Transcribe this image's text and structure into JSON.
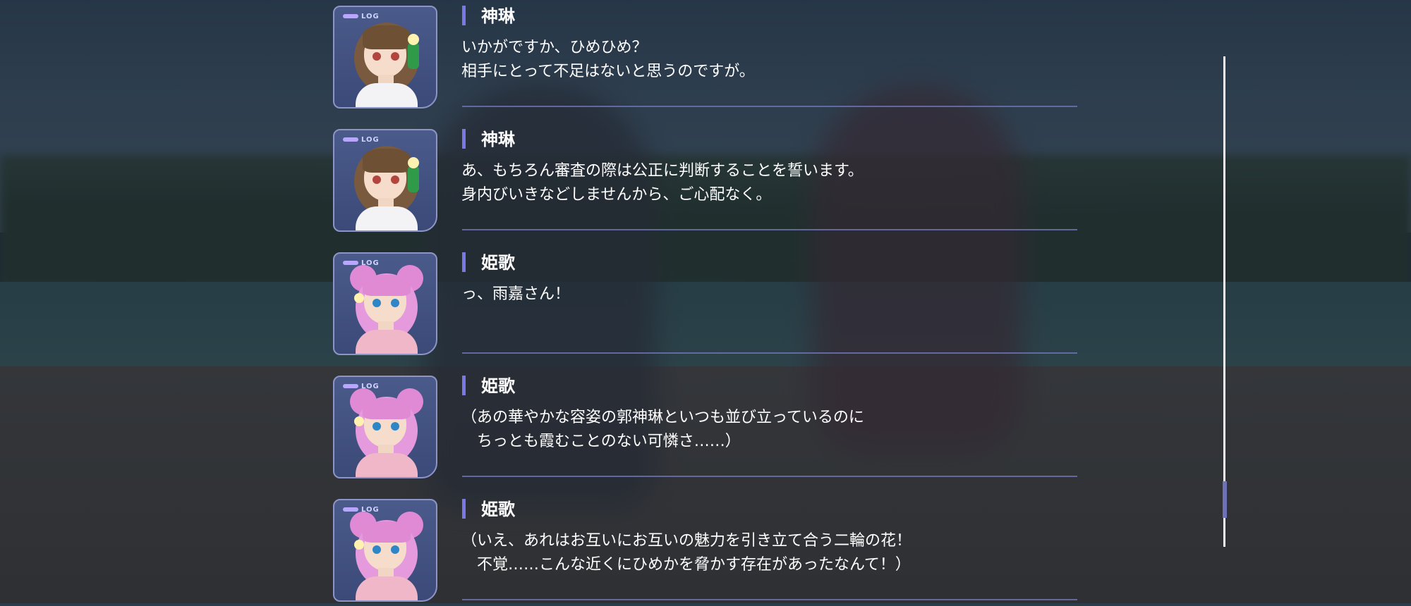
{
  "log_entries": [
    {
      "tag": "LOG",
      "character": "shenlin",
      "speaker": "神琳",
      "line1": "いかがですか、ひめひめ？",
      "line2": "相手にとって不足はないと思うのですが。"
    },
    {
      "tag": "LOG",
      "character": "shenlin",
      "speaker": "神琳",
      "line1": "あ、もちろん審査の際は公正に判断することを誓います。",
      "line2": "身内びいきなどしませんから、ご心配なく。"
    },
    {
      "tag": "LOG",
      "character": "himeka",
      "speaker": "姫歌",
      "line1": "っ、雨嘉さん！",
      "line2": ""
    },
    {
      "tag": "LOG",
      "character": "himeka",
      "speaker": "姫歌",
      "line1": "（あの華やかな容姿の郭神琳といつも並び立っているのに",
      "line2": "　ちっとも霞むことのない可憐さ……）"
    },
    {
      "tag": "LOG",
      "character": "himeka",
      "speaker": "姫歌",
      "line1": "（いえ、あれはお互いにお互いの魅力を引き立て合う二輪の花！",
      "line2": "　不覚……こんな近くにひめかを脅かす存在があったなんて！）"
    }
  ],
  "colors": {
    "accent_bar": "#7a78e6",
    "divider": "#6c72b0",
    "portrait_border": "#8e95c6",
    "shenlin_hair": "#7a5a3e",
    "himeka_hair": "#e08ad6"
  }
}
